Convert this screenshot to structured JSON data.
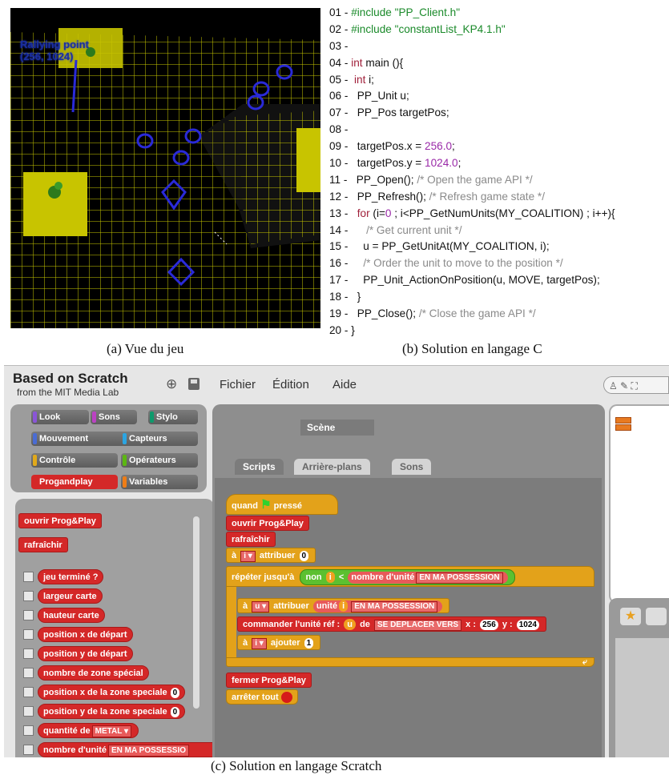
{
  "game": {
    "rally_line1": "Rallying point",
    "rally_line2": "(256, 1024)"
  },
  "code": {
    "lines": [
      {
        "n": "01 - ",
        "parts": [
          [
            "pre",
            "#include \"PP_Client.h\""
          ]
        ]
      },
      {
        "n": "02 - ",
        "parts": [
          [
            "pre",
            "#include \"constantList_KP4.1.h\""
          ]
        ]
      },
      {
        "n": "03 - ",
        "parts": []
      },
      {
        "n": "04 - ",
        "parts": [
          [
            "kw",
            "int"
          ],
          [
            "plain",
            " main (){"
          ]
        ]
      },
      {
        "n": "05 - ",
        "parts": [
          [
            "plain",
            " "
          ],
          [
            "kw",
            "int"
          ],
          [
            "plain",
            " i;"
          ]
        ]
      },
      {
        "n": "06 - ",
        "parts": [
          [
            "plain",
            "  PP_Unit u;"
          ]
        ]
      },
      {
        "n": "07 - ",
        "parts": [
          [
            "plain",
            "  PP_Pos targetPos;"
          ]
        ]
      },
      {
        "n": "08 - ",
        "parts": []
      },
      {
        "n": "09 - ",
        "parts": [
          [
            "plain",
            "  targetPos.x = "
          ],
          [
            "lit",
            "256.0"
          ],
          [
            "plain",
            ";"
          ]
        ]
      },
      {
        "n": "10 - ",
        "parts": [
          [
            "plain",
            "  targetPos.y = "
          ],
          [
            "lit",
            "1024.0"
          ],
          [
            "plain",
            ";"
          ]
        ]
      },
      {
        "n": "11 - ",
        "parts": [
          [
            "plain",
            "  PP_Open(); "
          ],
          [
            "cm",
            "/* Open the game API */"
          ]
        ]
      },
      {
        "n": "12 - ",
        "parts": [
          [
            "plain",
            "  PP_Refresh(); "
          ],
          [
            "cm",
            "/* Refresh game state */"
          ]
        ]
      },
      {
        "n": "13 - ",
        "parts": [
          [
            "plain",
            "  "
          ],
          [
            "kw",
            "for"
          ],
          [
            "plain",
            " (i="
          ],
          [
            "lit",
            "0"
          ],
          [
            "plain",
            " ; i<PP_GetNumUnits(MY_COALITION) ; i++){"
          ]
        ]
      },
      {
        "n": "14 - ",
        "parts": [
          [
            "plain",
            "     "
          ],
          [
            "cm",
            "/* Get current unit */"
          ]
        ]
      },
      {
        "n": "15 - ",
        "parts": [
          [
            "plain",
            "    u = PP_GetUnitAt(MY_COALITION, i);"
          ]
        ]
      },
      {
        "n": "16 - ",
        "parts": [
          [
            "plain",
            "    "
          ],
          [
            "cm",
            "/* Order the unit to move to the position */"
          ]
        ]
      },
      {
        "n": "17 - ",
        "parts": [
          [
            "plain",
            "    PP_Unit_ActionOnPosition(u, MOVE, targetPos);"
          ]
        ]
      },
      {
        "n": "18 - ",
        "parts": [
          [
            "plain",
            "  }"
          ]
        ]
      },
      {
        "n": "19 - ",
        "parts": [
          [
            "plain",
            "  PP_Close(); "
          ],
          [
            "cm",
            "/* Close the game API */"
          ]
        ]
      },
      {
        "n": "20 - ",
        "parts": [
          [
            "plain",
            "}"
          ]
        ]
      }
    ]
  },
  "captions": {
    "a": "(a) Vue du jeu",
    "b": "(b) Solution en langage C",
    "c": "(c) Solution en langage Scratch"
  },
  "scratch": {
    "title": "Based on Scratch",
    "subtitle": "from the MIT Media Lab",
    "menu": [
      "Fichier",
      "Édition",
      "Aide"
    ],
    "categories": [
      {
        "label": "Look",
        "color": "#8a55d7"
      },
      {
        "label": "Sons",
        "color": "#bb42c3"
      },
      {
        "label": "Stylo",
        "color": "#0e9a6c"
      },
      {
        "label": "Mouvement",
        "color": "#4a6cd4"
      },
      {
        "label": "Capteurs",
        "color": "#2ca5e2"
      },
      {
        "label": "Contrôle",
        "color": "#e1a91a"
      },
      {
        "label": "Opérateurs",
        "color": "#5cb712"
      },
      {
        "label": "Progandplay",
        "color": "#d42828"
      },
      {
        "label": "Variables",
        "color": "#ee7d16"
      }
    ],
    "palette": {
      "ouvrir": "ouvrir Prog&Play",
      "rafraichir": "rafraîchir",
      "jeu_termine": "jeu terminé ?",
      "largeur": "largeur carte",
      "hauteur": "hauteur carte",
      "posx": "position x de départ",
      "posy": "position y de départ",
      "nbzone": "nombre de zone spécial",
      "zonex": "position x de la zone speciale",
      "zoney": "position y de la zone speciale",
      "zero": "0",
      "quantite": "quantité de",
      "metal": "METAL",
      "nbunit": "nombre d'unité",
      "possession": "EN MA POSSESSIO"
    },
    "scene_label": "Scène",
    "tabs": [
      "Scripts",
      "Arrière-plans",
      "Sons"
    ],
    "script": {
      "quand": "quand",
      "presse": "pressé",
      "ouvrir": "ouvrir Prog&Play",
      "rafraichir": "rafraîchir",
      "a": "à",
      "i": "i",
      "u": "u",
      "attribuer": "attribuer",
      "zero": "0",
      "repeter": "répéter jusqu'à",
      "non": "non",
      "lt": "<",
      "nbunit": "nombre d'unité",
      "enma": "EN MA POSSESSION",
      "unite": "unité",
      "commander": "commander l'unité réf :",
      "de": "de",
      "deplacer": "SE DEPLACER VERS",
      "x": "x :",
      "xv": "256",
      "y": "y :",
      "yv": "1024",
      "ajouter": "ajouter",
      "one": "1",
      "fermer": "fermer Prog&Play",
      "arreter": "arrêter tout"
    }
  }
}
